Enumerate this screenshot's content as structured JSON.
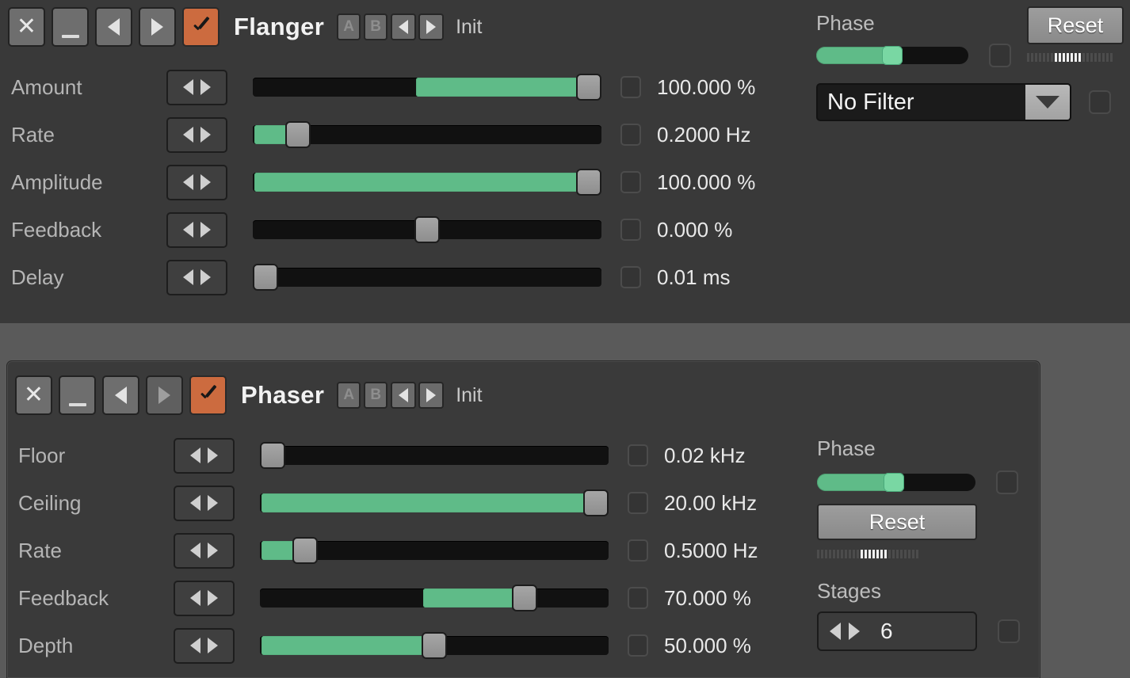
{
  "flanger": {
    "title": "Flanger",
    "header": {
      "close_label": "X",
      "minimize_label": "_",
      "prev_label": "prev",
      "next_label": "next",
      "enabled_label": "enabled",
      "preset_a": "A",
      "preset_b": "B",
      "preset_prev": "prev-preset",
      "preset_next": "next-preset",
      "init_label": "Init"
    },
    "params": [
      {
        "label": "Amount",
        "value": "100.000 %",
        "fill_start": 50,
        "fill_end": 100,
        "knob": 100
      },
      {
        "label": "Rate",
        "value": "0.2000 Hz",
        "fill_start": 0,
        "fill_end": 10,
        "knob": 10
      },
      {
        "label": "Amplitude",
        "value": "100.000 %",
        "fill_start": 0,
        "fill_end": 100,
        "knob": 100
      },
      {
        "label": "Feedback",
        "value": "0.000 %",
        "fill_start": 0,
        "fill_end": 0,
        "knob": 50
      },
      {
        "label": "Delay",
        "value": "0.01 ms",
        "fill_start": 0,
        "fill_end": 0,
        "knob": 0
      }
    ],
    "side": {
      "phase_label": "Phase",
      "phase_value": 50,
      "reset_label": "Reset",
      "ticks_total": 22,
      "ticks_on_start": 7,
      "ticks_on_end": 13,
      "filter_value": "No Filter"
    }
  },
  "phaser": {
    "title": "Phaser",
    "header": {
      "close_label": "X",
      "minimize_label": "_",
      "prev_label": "prev",
      "next_label": "next",
      "enabled_label": "enabled",
      "preset_a": "A",
      "preset_b": "B",
      "preset_prev": "prev-preset",
      "preset_next": "next-preset",
      "init_label": "Init"
    },
    "params": [
      {
        "label": "Floor",
        "value": "0.02 kHz",
        "fill_start": 0,
        "fill_end": 0,
        "knob": 0
      },
      {
        "label": "Ceiling",
        "value": "20.00 kHz",
        "fill_start": 0,
        "fill_end": 100,
        "knob": 100
      },
      {
        "label": "Rate",
        "value": "0.5000 Hz",
        "fill_start": 0,
        "fill_end": 10,
        "knob": 10
      },
      {
        "label": "Feedback",
        "value": "70.000 %",
        "fill_start": 50,
        "fill_end": 78,
        "knob": 78
      },
      {
        "label": "Depth",
        "value": "50.000 %",
        "fill_start": 0,
        "fill_end": 50,
        "knob": 50
      }
    ],
    "side": {
      "phase_label": "Phase",
      "phase_value": 48,
      "reset_label": "Reset",
      "ticks_total": 26,
      "ticks_on_start": 11,
      "ticks_on_end": 17,
      "stages_label": "Stages",
      "stages_value": "6"
    }
  },
  "colors": {
    "accent_green": "#5fbb88",
    "enabled_orange": "#cc6b3f",
    "panel_bg": "#3a3a3a",
    "desktop_bg": "#5a5a5a",
    "track_dark": "#111111"
  }
}
